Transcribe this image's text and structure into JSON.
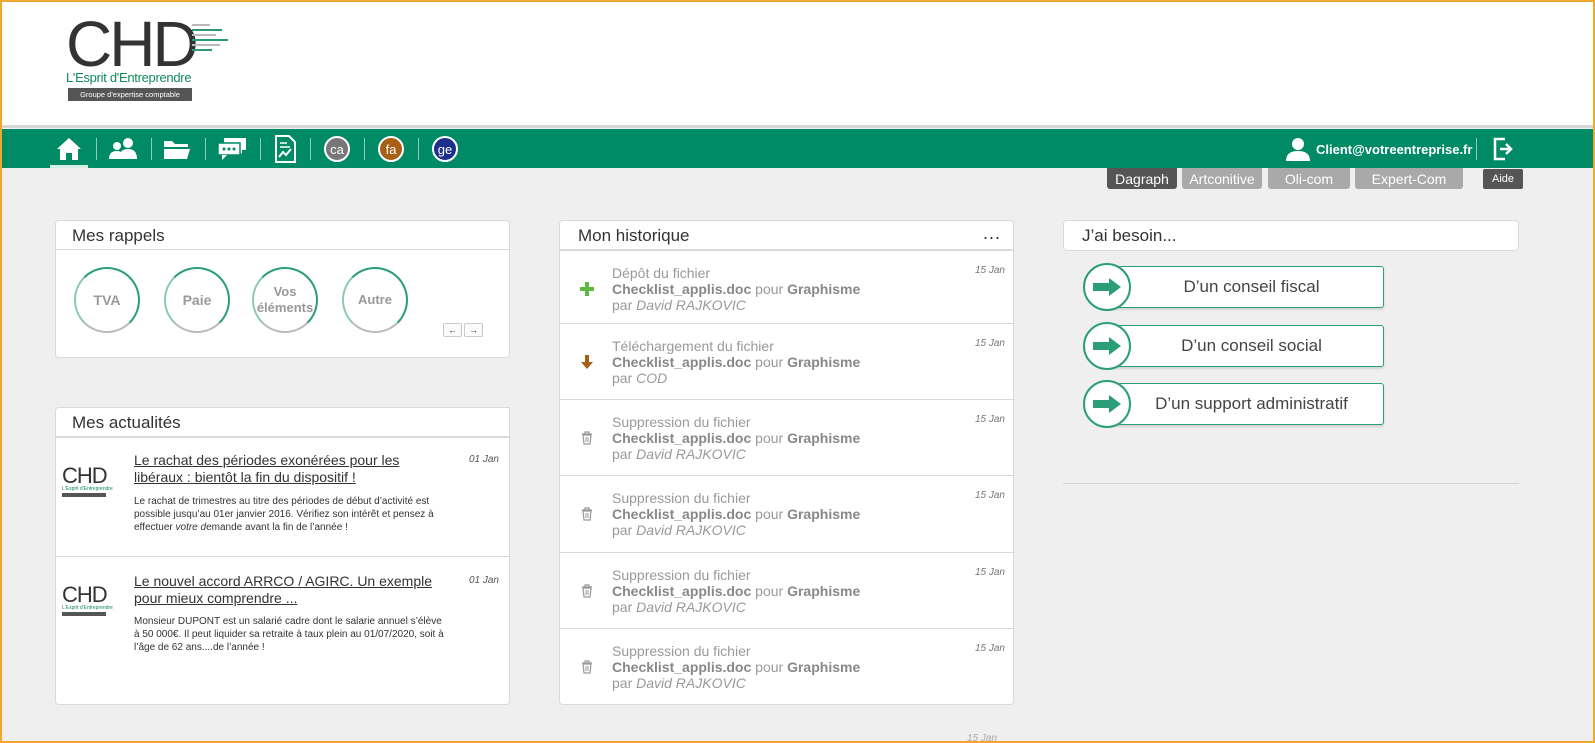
{
  "logo": {
    "letters": "CHD",
    "tagline": "L'Esprit d'Entreprendre",
    "subtitle": "Groupe d'expertise comptable"
  },
  "nav": {
    "circles": [
      "ca",
      "fa",
      "ge"
    ],
    "user_email": "Client@votreentreprise.fr"
  },
  "tabs": [
    "Dagraph",
    "Artconitive",
    "Oli-com",
    "Expert-Com"
  ],
  "aide": "Aide",
  "rappels": {
    "title": "Mes rappels",
    "items": [
      "TVA",
      "Paie",
      "Vos éléments",
      "Autre"
    ],
    "prev": "←",
    "next": "→"
  },
  "actualites": {
    "title": "Mes actualités",
    "items": [
      {
        "title": "Le rachat des périodes exonérées pour les libéraux : bientôt la fin du dispositif !",
        "date": "01 Jan",
        "body_1": "Le rachat de trimestres au titre des périodes de début d’activité est possible jusqu’au 01er janvier 2016. Vérifiez son intérêt et pensez à effectuer ",
        "body_em": "votre d",
        "body_2": "emande avant la fin de l’année !"
      },
      {
        "title": "Le nouvel accord ARRCO / AGIRC. Un exemple pour mieux comprendre ...",
        "date": "01 Jan",
        "body_1": "Monsieur DUPONT est un salarié cadre dont le salarie annuel s’élève à 50 000€. Il peut liquider sa retraite à taux plein au 01/07/2020, soit à l’âge de 62 ans....de l’année !",
        "body_em": "",
        "body_2": ""
      }
    ]
  },
  "historique": {
    "title": "Mon historique",
    "more": "...",
    "word_pour": "pour",
    "word_par": "par",
    "items": [
      {
        "action": "Dépôt du fichier",
        "file": "Checklist_applis.doc",
        "target": "Graphisme",
        "author": "David RAJKOVIC",
        "date": "15 Jan",
        "icon": "plus-icon"
      },
      {
        "action": "Téléchargement du fichier",
        "file": "Checklist_applis.doc",
        "target": "Graphisme",
        "author": "COD",
        "date": "15 Jan",
        "icon": "download-arrow-icon"
      },
      {
        "action": "Suppression du fichier",
        "file": "Checklist_applis.doc",
        "target": "Graphisme",
        "author": "David RAJKOVIC",
        "date": "15 Jan",
        "icon": "trash-icon"
      },
      {
        "action": "Suppression du fichier",
        "file": "Checklist_applis.doc",
        "target": "Graphisme",
        "author": "David RAJKOVIC",
        "date": "15 Jan",
        "icon": "trash-icon"
      },
      {
        "action": "Suppression du fichier",
        "file": "Checklist_applis.doc",
        "target": "Graphisme",
        "author": "David RAJKOVIC",
        "date": "15 Jan",
        "icon": "trash-icon"
      },
      {
        "action": "Suppression du fichier",
        "file": "Checklist_applis.doc",
        "target": "Graphisme",
        "author": "David RAJKOVIC",
        "date": "15 Jan",
        "icon": "trash-icon"
      }
    ],
    "bottom_date": "15 Jan"
  },
  "besoin": {
    "title": "J’ai besoin...",
    "buttons": [
      "D’un conseil fiscal",
      "D’un conseil social",
      "D’un support administratif"
    ]
  },
  "colors": {
    "brand_green": "#018a66",
    "accent_green": "#2b9d78",
    "frame_orange": "#f0a830",
    "tab_dark": "#555555",
    "tab_light": "#a9a9a9"
  }
}
